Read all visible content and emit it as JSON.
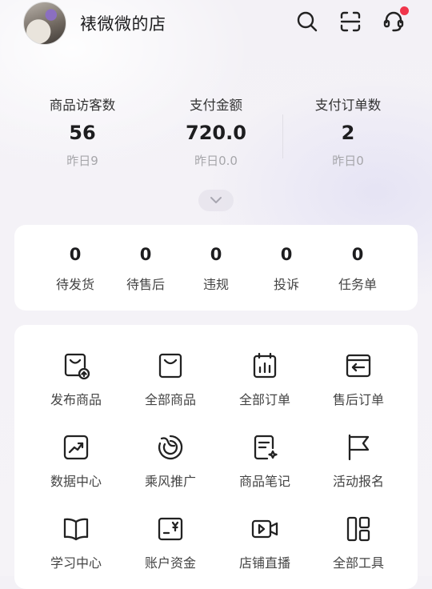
{
  "header": {
    "shop_name": "裱微微的店",
    "icons": [
      "search-icon",
      "scan-icon",
      "customer-service-icon"
    ],
    "has_notification": true
  },
  "stats": [
    {
      "label": "商品访客数",
      "value": "56",
      "yesterday": "昨日9"
    },
    {
      "label": "支付金额",
      "value": "720.0",
      "yesterday": "昨日0.0"
    },
    {
      "label": "支付订单数",
      "value": "2",
      "yesterday": "昨日0"
    }
  ],
  "pending": [
    {
      "value": "0",
      "label": "待发货"
    },
    {
      "value": "0",
      "label": "待售后"
    },
    {
      "value": "0",
      "label": "违规"
    },
    {
      "value": "0",
      "label": "投诉"
    },
    {
      "value": "0",
      "label": "任务单"
    }
  ],
  "tools": [
    {
      "label": "发布商品",
      "icon": "publish-product-icon"
    },
    {
      "label": "全部商品",
      "icon": "shopping-bag-icon"
    },
    {
      "label": "全部订单",
      "icon": "orders-icon"
    },
    {
      "label": "售后订单",
      "icon": "after-sales-icon"
    },
    {
      "label": "数据中心",
      "icon": "chart-trend-icon"
    },
    {
      "label": "乘风推广",
      "icon": "promotion-icon"
    },
    {
      "label": "商品笔记",
      "icon": "notes-icon"
    },
    {
      "label": "活动报名",
      "icon": "flag-icon"
    },
    {
      "label": "学习中心",
      "icon": "book-icon"
    },
    {
      "label": "账户资金",
      "icon": "wallet-icon"
    },
    {
      "label": "店铺直播",
      "icon": "video-icon"
    },
    {
      "label": "全部工具",
      "icon": "grid-icon"
    }
  ],
  "colors": {
    "accent_red": "#f0354b",
    "text_primary": "#1d1d1f",
    "text_muted": "#a6a6aa"
  }
}
